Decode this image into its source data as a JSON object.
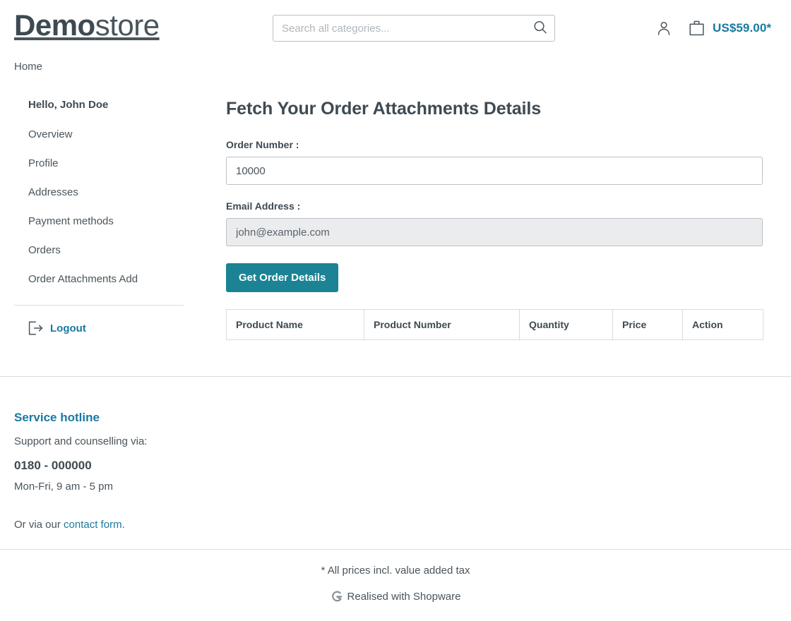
{
  "header": {
    "logo_bold": "Demo",
    "logo_light": "store",
    "search_placeholder": "Search all categories...",
    "search_value": "",
    "search_icon": "search-icon",
    "account_icon": "user-icon",
    "cart_icon": "shopping-bag-icon",
    "cart_total": "US$59.00*"
  },
  "breadcrumb": {
    "home": "Home"
  },
  "sidebar": {
    "greeting": "Hello, John Doe",
    "items": [
      {
        "label": "Overview"
      },
      {
        "label": "Profile"
      },
      {
        "label": "Addresses"
      },
      {
        "label": "Payment methods"
      },
      {
        "label": "Orders"
      },
      {
        "label": "Order Attachments Add"
      }
    ],
    "logout_label": "Logout",
    "logout_icon": "logout-icon"
  },
  "main": {
    "title": "Fetch Your Order Attachments Details",
    "order_number_label": "Order Number :",
    "order_number_value": "10000",
    "email_label": "Email Address :",
    "email_value": "john@example.com",
    "submit_label": "Get Order Details",
    "table": {
      "columns": [
        "Product Name",
        "Product Number",
        "Quantity",
        "Price",
        "Action"
      ],
      "rows": []
    }
  },
  "footer": {
    "hotline_title": "Service hotline",
    "support_text": "Support and counselling via:",
    "phone": "0180 - 000000",
    "hours": "Mon-Fri, 9 am - 5 pm",
    "contact_prefix": "Or via our ",
    "contact_link": "contact form",
    "contact_suffix": ".",
    "tax_note": "* All prices incl. value added tax",
    "realised_text": "Realised with Shopware",
    "shopware_icon": "shopware-logo-icon"
  },
  "colors": {
    "accent": "#1979a0",
    "button": "#1b8394",
    "text": "#4a545b",
    "heading": "#3e4a52",
    "border": "#bcc1c7",
    "divider": "#d8dce0",
    "disabled_bg": "#eaecee"
  }
}
